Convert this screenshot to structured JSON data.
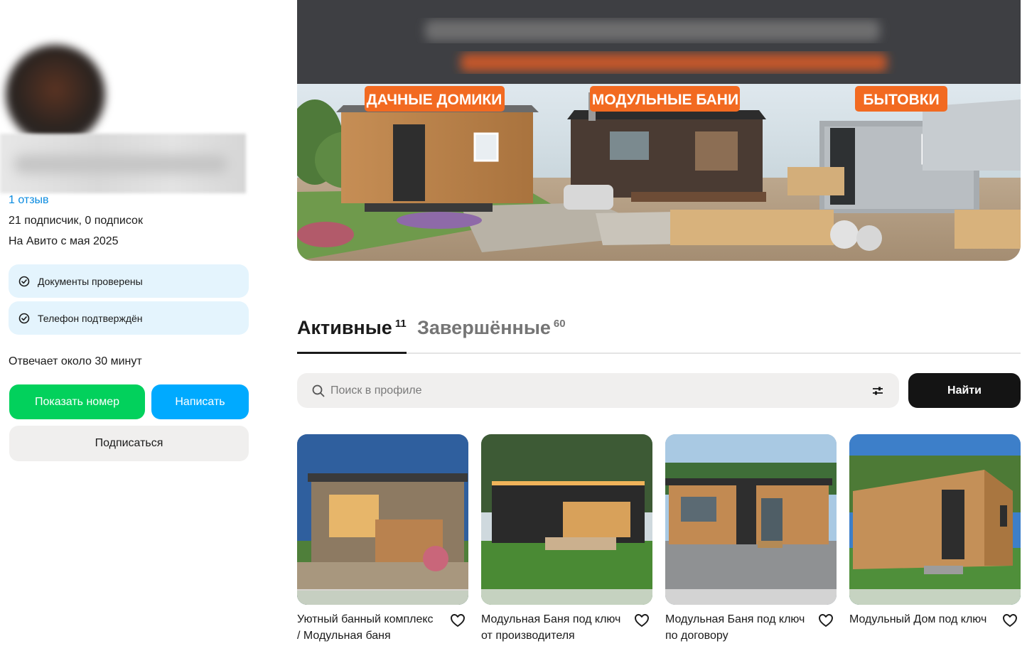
{
  "seller": {
    "reviews_label": "1 отзыв",
    "subscribers_label": "21 подписчик, 0 подписок",
    "since_label": "На Авито с мая 2025",
    "badges": [
      {
        "label": "Документы проверены",
        "icon": "check-circle-icon"
      },
      {
        "label": "Телефон подтверждён",
        "icon": "check-circle-icon"
      }
    ],
    "response_time": "Отвечает около 30 минут",
    "buttons": {
      "show_phone": "Показать номер",
      "write": "Написать",
      "subscribe": "Подписаться"
    }
  },
  "banner": {
    "labels": [
      "ДАЧНЫЕ ДОМИКИ",
      "МОДУЛЬНЫЕ БАНИ",
      "БЫТОВКИ"
    ],
    "label_color": "#f26a21"
  },
  "tabs": [
    {
      "label": "Активные",
      "count": "11",
      "active": true
    },
    {
      "label": "Завершённые",
      "count": "60",
      "active": false
    }
  ],
  "search": {
    "placeholder": "Поиск в профиле",
    "value": "",
    "button_label": "Найти"
  },
  "listings": [
    {
      "title": "Уютный банный комплекс / Модульная баня",
      "icon": "heart-icon"
    },
    {
      "title": "Модульная Баня под ключ от производителя",
      "icon": "heart-icon"
    },
    {
      "title": "Модульная Баня под ключ по договору",
      "icon": "heart-icon"
    },
    {
      "title": "Модульный Дом под ключ",
      "icon": "heart-icon"
    }
  ],
  "colors": {
    "green_button": "#02d15c",
    "blue_button": "#00aaff",
    "link": "#0a8be0",
    "badge_bg": "#e4f4fd",
    "find_button": "#141414"
  }
}
